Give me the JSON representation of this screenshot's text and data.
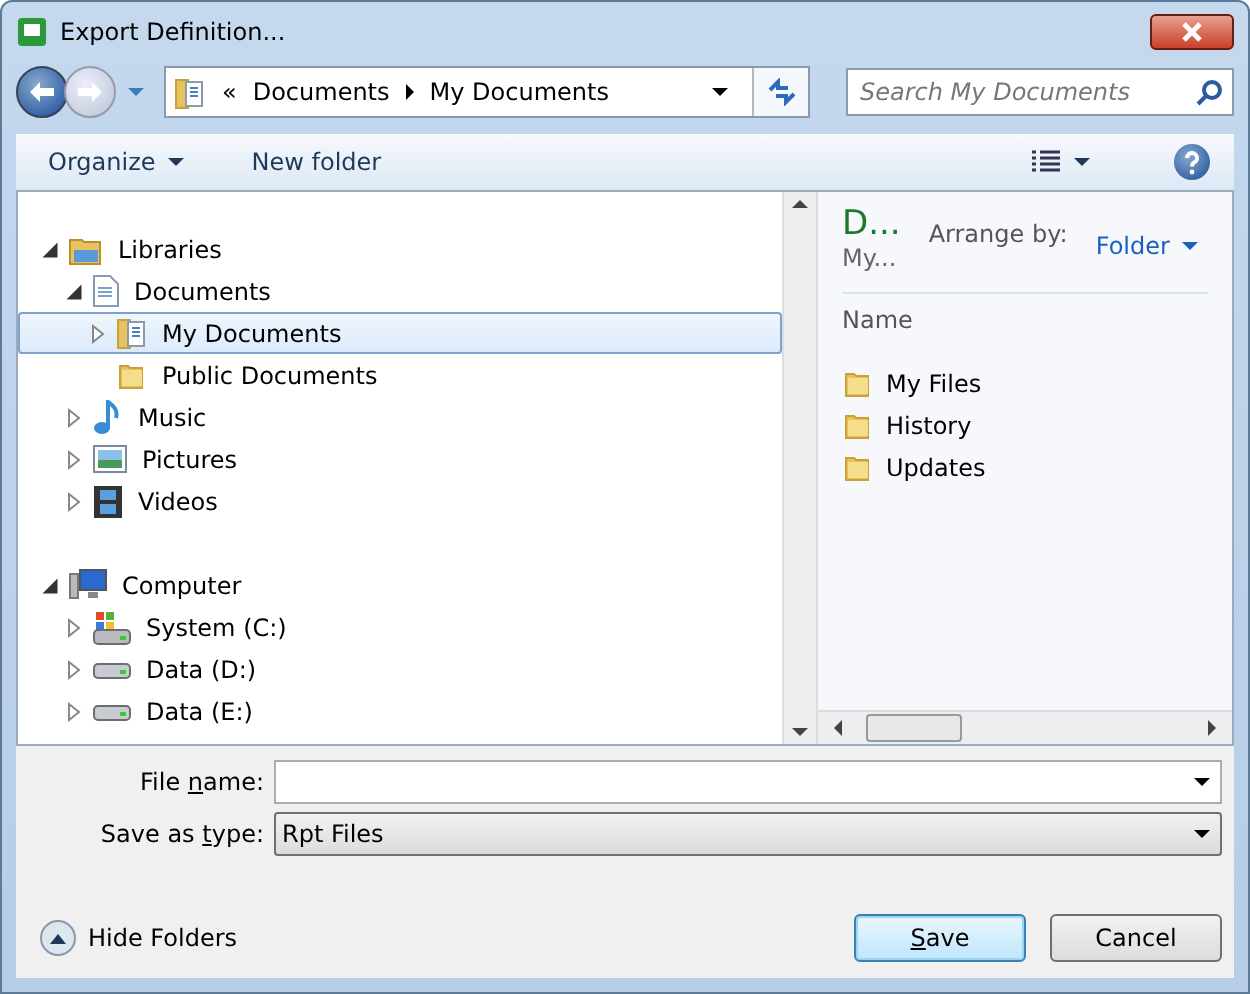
{
  "window": {
    "title": "Export Definition..."
  },
  "address": {
    "overflow": "«",
    "crumbs": [
      "Documents",
      "My Documents"
    ]
  },
  "search": {
    "placeholder": "Search My Documents"
  },
  "toolbar": {
    "organize": "Organize",
    "new_folder": "New folder"
  },
  "tree": [
    {
      "label": "Libraries",
      "kind": "library",
      "expandable": true,
      "expanded": true,
      "selected": false,
      "children": [
        {
          "label": "Documents",
          "kind": "doclib",
          "expandable": true,
          "expanded": true,
          "selected": false,
          "children": [
            {
              "label": "My Documents",
              "kind": "docfolder",
              "expandable": true,
              "expanded": false,
              "selected": true
            },
            {
              "label": "Public Documents",
              "kind": "folder",
              "expandable": false,
              "selected": false
            }
          ]
        },
        {
          "label": "Music",
          "kind": "music",
          "expandable": true,
          "expanded": false,
          "selected": false
        },
        {
          "label": "Pictures",
          "kind": "pictures",
          "expandable": true,
          "expanded": false,
          "selected": false
        },
        {
          "label": "Videos",
          "kind": "videos",
          "expandable": true,
          "expanded": false,
          "selected": false
        }
      ]
    },
    {
      "label": "Computer",
      "kind": "computer",
      "expandable": true,
      "expanded": true,
      "selected": false,
      "children": [
        {
          "label": "System (C:)",
          "kind": "sysdrive",
          "expandable": true,
          "expanded": false,
          "selected": false
        },
        {
          "label": "Data (D:)",
          "kind": "drive",
          "expandable": true,
          "expanded": false,
          "selected": false
        },
        {
          "label": "Data (E:)",
          "kind": "drive",
          "expandable": true,
          "expanded": false,
          "selected": false
        }
      ]
    }
  ],
  "library_header": {
    "title": "D...",
    "subtitle": "My...",
    "arrange_label": "Arrange by:",
    "arrange_value": "Folder"
  },
  "file_list": {
    "column": "Name",
    "items": [
      "My Files",
      "History",
      "Updates"
    ]
  },
  "file_name": {
    "label_parts": [
      {
        "text": "File ",
        "access_key": false
      },
      {
        "text": "n",
        "access_key": true
      },
      {
        "text": "ame:",
        "access_key": false
      }
    ]
  },
  "save_type": {
    "label_parts": [
      {
        "text": "Save as ",
        "access_key": false
      },
      {
        "text": "t",
        "access_key": true
      },
      {
        "text": "ype:",
        "access_key": false
      }
    ],
    "value": "Rpt Files"
  },
  "hide_folders": "Hide Folders",
  "buttons": [
    {
      "label_parts": [
        {
          "text": "S",
          "access_key": true
        },
        {
          "text": "ave",
          "access_key": false
        }
      ],
      "kind": "default"
    },
    {
      "label_parts": [
        {
          "text": "Cancel",
          "access_key": false
        }
      ],
      "kind": "normal"
    }
  ]
}
